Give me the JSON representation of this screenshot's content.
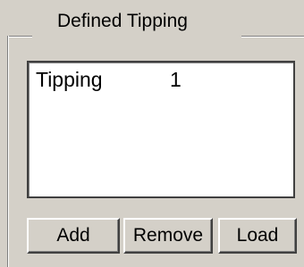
{
  "group": {
    "title": "Defined Tipping"
  },
  "list": {
    "items": [
      {
        "name": "Tipping",
        "value": "1"
      }
    ]
  },
  "buttons": {
    "add": "Add",
    "remove": "Remove",
    "load": "Load"
  }
}
